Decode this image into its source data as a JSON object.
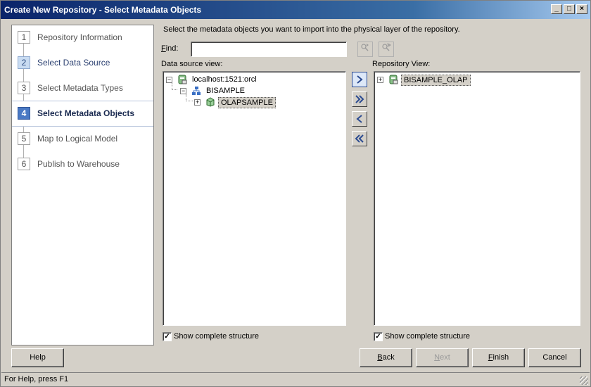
{
  "window": {
    "title": "Create New Repository - Select Metadata Objects",
    "controls": {
      "minimize": "_",
      "maximize": "□",
      "close": "×"
    }
  },
  "steps": [
    {
      "num": "1",
      "label": "Repository Information",
      "state": "pending"
    },
    {
      "num": "2",
      "label": "Select Data Source",
      "state": "done"
    },
    {
      "num": "3",
      "label": "Select Metadata Types",
      "state": "pending"
    },
    {
      "num": "4",
      "label": "Select Metadata Objects",
      "state": "current"
    },
    {
      "num": "5",
      "label": "Map to Logical Model",
      "state": "pending"
    },
    {
      "num": "6",
      "label": "Publish to Warehouse",
      "state": "pending"
    }
  ],
  "main": {
    "instruction": "Select the metadata objects you want to import into the physical layer of the repository.",
    "find": {
      "label_prefix": "",
      "label_key": "F",
      "label_rest": "ind:",
      "value": ""
    },
    "source_view": {
      "label": "Data source view:",
      "nodes": [
        {
          "text": "localhost:1521:orcl",
          "icon": "database-connection-icon",
          "expander": "−"
        },
        {
          "text": "BISAMPLE",
          "icon": "schema-icon",
          "expander": "−"
        },
        {
          "text": "OLAPSAMPLE",
          "icon": "cube-icon",
          "expander": "+",
          "selected": true
        }
      ],
      "show_complete_structure": {
        "checked": true,
        "label": "Show complete structure"
      }
    },
    "repository_view": {
      "label": "Repository View:",
      "nodes": [
        {
          "text": "BISAMPLE_OLAP",
          "icon": "database-connection-icon",
          "expander": "+",
          "selected": true
        }
      ],
      "show_complete_structure": {
        "checked": true,
        "label": "Show complete structure"
      }
    },
    "move_buttons": {
      "add": "add-selected-icon",
      "add_all": "add-all-icon",
      "remove": "remove-selected-icon",
      "remove_all": "remove-all-icon"
    }
  },
  "buttons": {
    "help": "Help",
    "back_key": "B",
    "back_rest": "ack",
    "next_key": "N",
    "next_rest": "ext",
    "finish_key": "F",
    "finish_rest": "inish",
    "cancel": "Cancel"
  },
  "status": "For Help, press F1",
  "colors": {
    "title_start": "#0a246a",
    "title_end": "#a6caf0",
    "step_current": "#4a79c4",
    "step_done": "#c9dcf2"
  }
}
